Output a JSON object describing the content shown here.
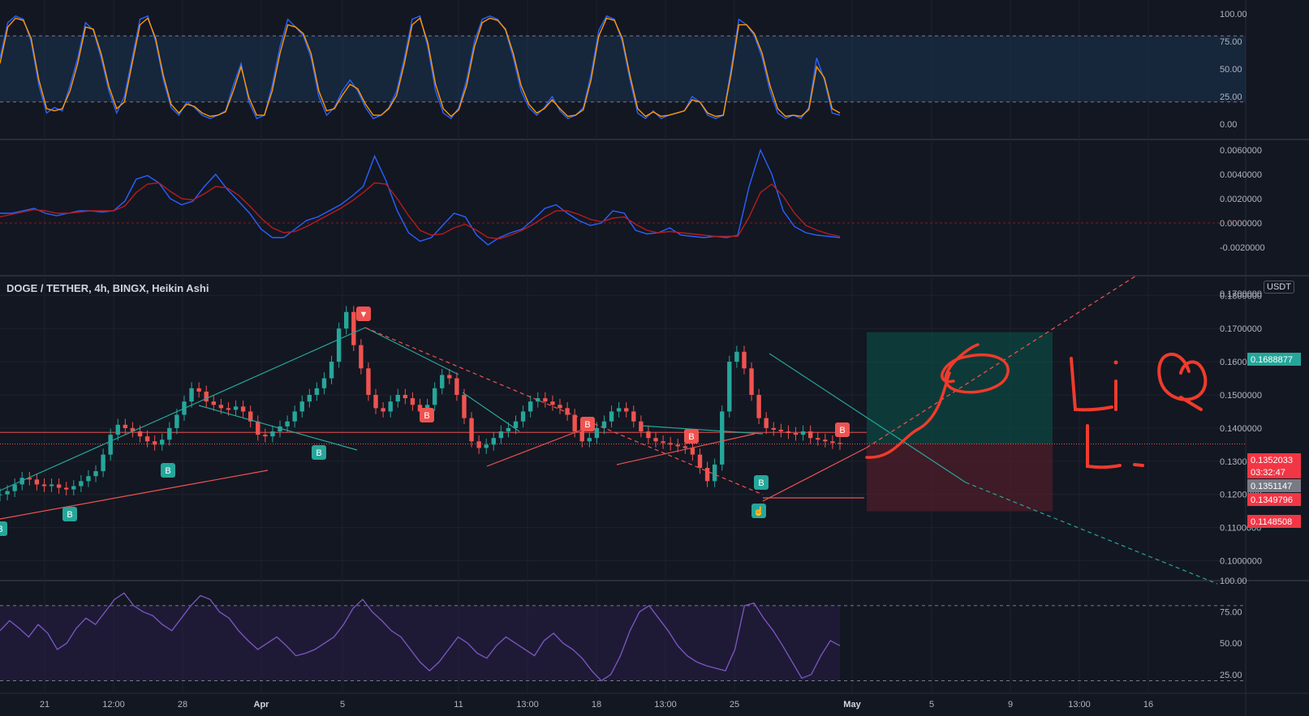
{
  "header": {
    "symbol": "DOGE / TETHER, 4h, BINGX, Heikin Ashi",
    "quote_currency": "USDT"
  },
  "colors": {
    "background": "#131722",
    "grid": "#1e222d",
    "bull": "#26a69a",
    "bear": "#ef5350",
    "stoch_k": "#2962ff",
    "stoch_d": "#ff9800",
    "macd": "#2962ff",
    "signal": "#b71c1c",
    "rsi": "#7e57c2",
    "trend_up": "#ef5350",
    "trend_channel": "#26a69a",
    "long_profit_zone": "#0e3b3a",
    "long_loss_zone": "#3a1a22"
  },
  "time_axis": {
    "labels": [
      "21",
      "12:00",
      "28",
      "Apr",
      "5",
      "11",
      "13:00",
      "18",
      "13:00",
      "25",
      "May",
      "5",
      "9",
      "13:00",
      "16"
    ]
  },
  "chart_data": [
    {
      "type": "line",
      "title": "",
      "y_ticks": [
        "100.00",
        "75.00",
        "50.00",
        "25.00",
        "0.00"
      ],
      "ylim": [
        0,
        100
      ],
      "overbought": 80,
      "oversold": 20,
      "series": [
        {
          "values": [
            60,
            92,
            98,
            95,
            75,
            35,
            10,
            15,
            12,
            35,
            60,
            92,
            85,
            60,
            30,
            10,
            25,
            60,
            95,
            98,
            75,
            40,
            15,
            8,
            20,
            15,
            8,
            5,
            8,
            12,
            35,
            55,
            20,
            5,
            8,
            35,
            70,
            95,
            88,
            80,
            60,
            25,
            8,
            15,
            30,
            40,
            30,
            15,
            5,
            8,
            15,
            30,
            60,
            95,
            98,
            70,
            30,
            10,
            5,
            15,
            40,
            75,
            95,
            98,
            95,
            85,
            60,
            30,
            15,
            8,
            15,
            25,
            12,
            5,
            8,
            15,
            45,
            85,
            98,
            95,
            75,
            40,
            10,
            5,
            12,
            5,
            8,
            10,
            12,
            25,
            20,
            8,
            5,
            8,
            50,
            95,
            90,
            80,
            60,
            30,
            10,
            5,
            8,
            5,
            15,
            60,
            40,
            10,
            8
          ]
        },
        {
          "values": [
            55,
            88,
            96,
            94,
            78,
            40,
            14,
            12,
            14,
            30,
            55,
            88,
            86,
            64,
            34,
            14,
            20,
            55,
            90,
            96,
            78,
            44,
            18,
            10,
            18,
            16,
            10,
            7,
            8,
            11,
            30,
            52,
            24,
            8,
            8,
            30,
            64,
            90,
            88,
            82,
            64,
            30,
            12,
            14,
            26,
            36,
            32,
            18,
            8,
            8,
            14,
            26,
            55,
            90,
            96,
            74,
            36,
            14,
            7,
            13,
            35,
            70,
            92,
            96,
            94,
            86,
            64,
            35,
            18,
            10,
            14,
            22,
            14,
            7,
            8,
            13,
            40,
            80,
            96,
            94,
            78,
            44,
            14,
            7,
            11,
            7,
            8,
            10,
            12,
            22,
            20,
            10,
            7,
            8,
            45,
            90,
            90,
            82,
            64,
            35,
            14,
            7,
            8,
            7,
            13,
            52,
            42,
            14,
            10
          ]
        }
      ]
    },
    {
      "type": "line",
      "title": "",
      "y_ticks": [
        "0.0060000",
        "0.0040000",
        "0.0020000",
        "0.0000000",
        "-0.0020000"
      ],
      "ylim": [
        -0.003,
        0.006
      ],
      "series": [
        {
          "values": [
            0.0008,
            0.0008,
            0.001,
            0.0012,
            0.0008,
            0.0006,
            0.0008,
            0.001,
            0.001,
            0.0009,
            0.001,
            0.0018,
            0.0036,
            0.0039,
            0.0033,
            0.002,
            0.0015,
            0.0018,
            0.003,
            0.004,
            0.0028,
            0.0018,
            0.0008,
            -0.0005,
            -0.0012,
            -0.0012,
            -0.0005,
            0.0002,
            0.0005,
            0.001,
            0.0015,
            0.0022,
            0.003,
            0.0055,
            0.0035,
            0.001,
            -0.0008,
            -0.0015,
            -0.0012,
            -0.0002,
            0.0008,
            0.0005,
            -0.001,
            -0.0018,
            -0.0012,
            -0.0008,
            -0.0005,
            0.0003,
            0.0012,
            0.0015,
            0.0008,
            0.0002,
            -0.0002,
            0.0,
            0.001,
            0.0008,
            -0.0006,
            -0.0009,
            -0.0008,
            -0.0004,
            -0.001,
            -0.0011,
            -0.0012,
            -0.0011,
            -0.0012,
            -0.001,
            0.003,
            0.006,
            0.004,
            0.001,
            -0.0003,
            -0.0008,
            -0.001,
            -0.0011,
            -0.0012
          ]
        },
        {
          "values": [
            0.0005,
            0.0007,
            0.0009,
            0.0011,
            0.001,
            0.0008,
            0.0008,
            0.0009,
            0.001,
            0.001,
            0.001,
            0.0014,
            0.0025,
            0.0032,
            0.0033,
            0.0026,
            0.002,
            0.0019,
            0.0024,
            0.003,
            0.0029,
            0.0023,
            0.0014,
            0.0004,
            -0.0004,
            -0.0008,
            -0.0007,
            -0.0003,
            0.0002,
            0.0007,
            0.0012,
            0.0018,
            0.0025,
            0.0033,
            0.0032,
            0.002,
            0.0006,
            -0.0006,
            -0.001,
            -0.0009,
            -0.0004,
            -0.0001,
            -0.0006,
            -0.0012,
            -0.0013,
            -0.001,
            -0.0006,
            -0.0001,
            0.0005,
            0.001,
            0.001,
            0.0007,
            0.0003,
            0.0001,
            0.0004,
            0.0005,
            -0.0001,
            -0.0006,
            -0.0008,
            -0.0007,
            -0.0008,
            -0.0009,
            -0.001,
            -0.0011,
            -0.0011,
            -0.0011,
            0.0005,
            0.0025,
            0.0032,
            0.0022,
            0.0008,
            -0.0002,
            -0.0006,
            -0.0009,
            -0.0011
          ]
        }
      ]
    },
    {
      "type": "candlestick",
      "title": "DOGE / TETHER, 4h, BINGX, Heikin Ashi",
      "y_ticks": [
        "0.1700000",
        "0.1800000",
        "0.1700000",
        "0.1600000",
        "0.1500000",
        "0.1400000",
        "0.1300000",
        "0.1200000",
        "0.1100000",
        "0.1000000"
      ],
      "ylim": [
        0.095,
        0.183
      ],
      "closes": [
        0.12,
        0.121,
        0.123,
        0.125,
        0.1245,
        0.123,
        0.1225,
        0.123,
        0.122,
        0.1215,
        0.1225,
        0.124,
        0.1255,
        0.127,
        0.132,
        0.138,
        0.141,
        0.14,
        0.139,
        0.1375,
        0.136,
        0.135,
        0.1365,
        0.14,
        0.144,
        0.148,
        0.152,
        0.151,
        0.148,
        0.147,
        0.146,
        0.1455,
        0.1465,
        0.145,
        0.142,
        0.138,
        0.1375,
        0.139,
        0.1405,
        0.142,
        0.145,
        0.148,
        0.15,
        0.152,
        0.155,
        0.16,
        0.17,
        0.175,
        0.165,
        0.158,
        0.15,
        0.146,
        0.145,
        0.148,
        0.15,
        0.149,
        0.147,
        0.145,
        0.147,
        0.152,
        0.156,
        0.155,
        0.15,
        0.143,
        0.136,
        0.134,
        0.135,
        0.137,
        0.139,
        0.14,
        0.142,
        0.145,
        0.148,
        0.149,
        0.148,
        0.147,
        0.146,
        0.144,
        0.139,
        0.136,
        0.137,
        0.14,
        0.142,
        0.145,
        0.146,
        0.145,
        0.142,
        0.139,
        0.137,
        0.136,
        0.1355,
        0.135,
        0.1345,
        0.134,
        0.132,
        0.128,
        0.124,
        0.129,
        0.145,
        0.16,
        0.163,
        0.158,
        0.15,
        0.143,
        0.14,
        0.1395,
        0.139,
        0.1385,
        0.138,
        0.139,
        0.137,
        0.1365,
        0.136,
        0.1355,
        0.1352
      ]
    },
    {
      "type": "line",
      "title": "",
      "y_ticks": [
        "100.00",
        "75.00",
        "50.00",
        "25.00"
      ],
      "ylim": [
        10,
        100
      ],
      "upper_band": 80,
      "lower_band": 20,
      "series": [
        {
          "values": [
            60,
            68,
            62,
            55,
            65,
            58,
            45,
            50,
            62,
            70,
            65,
            75,
            85,
            90,
            80,
            75,
            72,
            65,
            60,
            70,
            80,
            88,
            85,
            75,
            70,
            60,
            52,
            45,
            50,
            55,
            48,
            40,
            42,
            45,
            50,
            55,
            65,
            78,
            85,
            75,
            68,
            60,
            55,
            45,
            35,
            28,
            35,
            45,
            55,
            50,
            42,
            38,
            48,
            55,
            50,
            45,
            40,
            52,
            58,
            50,
            45,
            38,
            28,
            20,
            25,
            40,
            60,
            75,
            80,
            70,
            60,
            48,
            40,
            35,
            32,
            30,
            28,
            45,
            80,
            82,
            70,
            60,
            48,
            35,
            22,
            25,
            40,
            52,
            48
          ]
        }
      ]
    }
  ],
  "annotations": {
    "price_labels": [
      "0.1688877",
      "0.1352033",
      "03:32:47",
      "0.1351147",
      "0.1349796",
      "0.1148508"
    ],
    "handwriting": "LiQ L."
  }
}
